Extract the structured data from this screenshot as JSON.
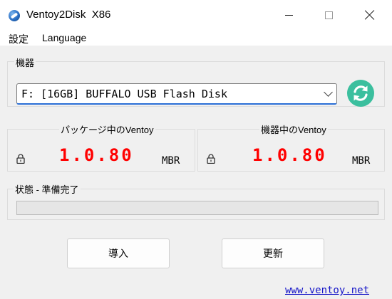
{
  "window": {
    "title": "Ventoy2Disk  X86",
    "controls": {
      "minimize": "minimize-icon",
      "maximize": "maximize-icon",
      "close": "close-icon"
    }
  },
  "menu": {
    "settings": "設定",
    "language": "Language"
  },
  "device": {
    "group_label": "機器",
    "selected": "F: [16GB] BUFFALO USB Flash Disk",
    "refresh_icon": "refresh-icon"
  },
  "package_version": {
    "label": "パッケージ中のVentoy",
    "version": "1.0.80",
    "partition_style": "MBR",
    "secure_boot_icon": "lock-icon"
  },
  "device_version": {
    "label": "機器中のVentoy",
    "version": "1.0.80",
    "partition_style": "MBR",
    "secure_boot_icon": "lock-icon"
  },
  "status": {
    "label": "状態 - 準備完了",
    "progress_fraction": 0
  },
  "buttons": {
    "install": "導入",
    "update": "更新"
  },
  "footer": {
    "website": "www.ventoy.net"
  },
  "colors": {
    "version_text": "#ff0000",
    "refresh_button": "#3bbf9e",
    "link": "#1515c8",
    "focus_accent": "#2b6fd6"
  }
}
